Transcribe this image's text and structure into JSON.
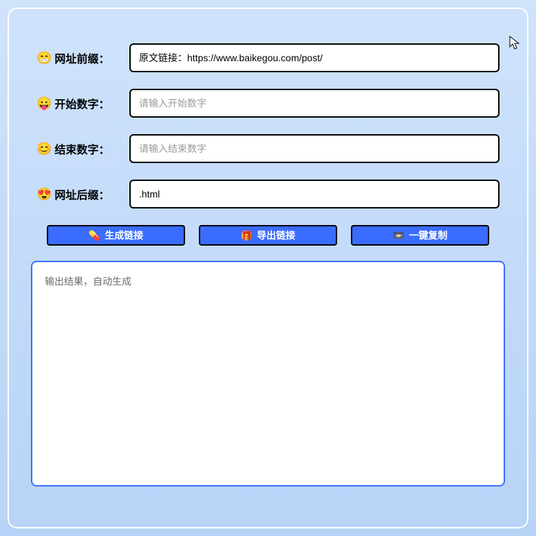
{
  "fields": {
    "prefix": {
      "emoji": "😁",
      "label": "网址前缀：",
      "value": "原文链接：https://www.baikegou.com/post/",
      "placeholder": ""
    },
    "start": {
      "emoji": "😛",
      "label": "开始数字：",
      "value": "",
      "placeholder": "请输入开始数字"
    },
    "end": {
      "emoji": "😊",
      "label": "结束数字：",
      "value": "",
      "placeholder": "请输入结束数字"
    },
    "suffix": {
      "emoji": "😍",
      "label": "网址后缀：",
      "value": ".html",
      "placeholder": ""
    }
  },
  "buttons": {
    "generate": {
      "icon": "💊",
      "label": "生成链接"
    },
    "export": {
      "icon": "🎁",
      "label": "导出链接"
    },
    "copy": {
      "icon": "📼",
      "label": "一键复制"
    }
  },
  "output": {
    "placeholder": "输出结果，自动生成"
  }
}
